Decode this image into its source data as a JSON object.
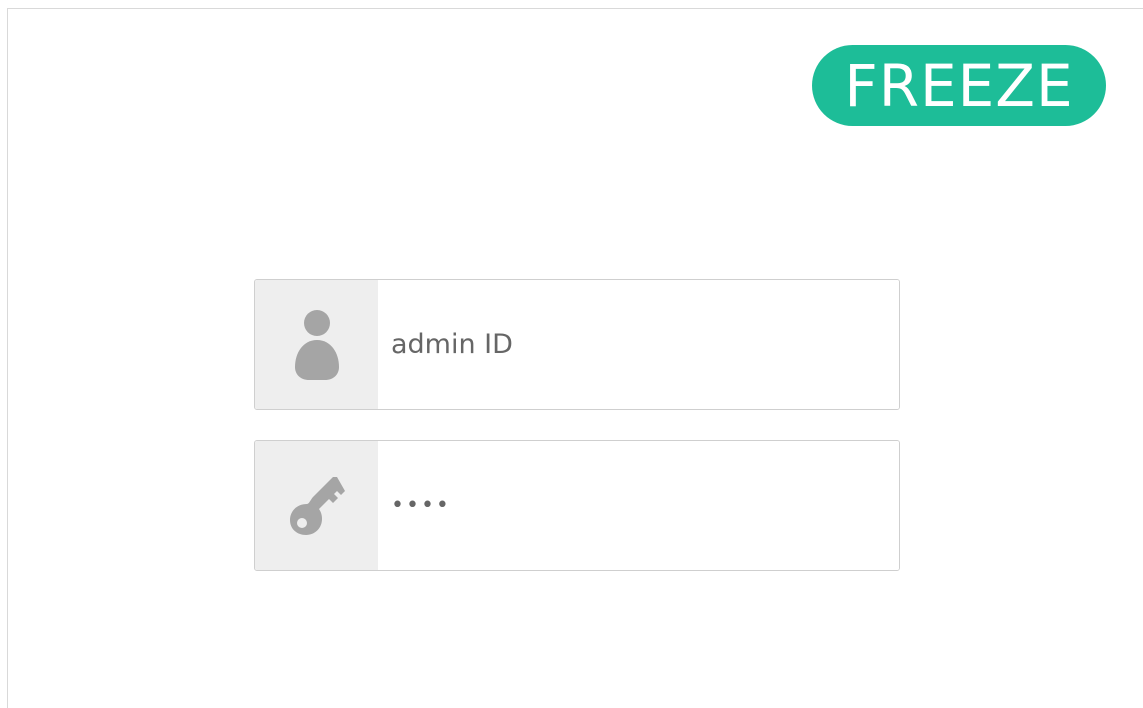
{
  "header": {
    "badge_label": "FREEZE",
    "badge_color": "#1dbd98"
  },
  "login": {
    "user_field": {
      "icon": "user-icon",
      "placeholder": "admin ID",
      "value": ""
    },
    "password_field": {
      "icon": "key-icon",
      "placeholder": "",
      "value": "1234"
    }
  }
}
